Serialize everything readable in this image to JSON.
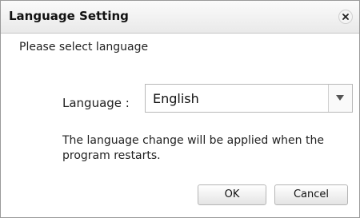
{
  "dialog": {
    "title": "Language Setting",
    "close_icon": "close-icon",
    "prompt": "Please select language",
    "language_label": "Language :",
    "language_select": {
      "selected": "English",
      "arrow_icon": "triangle-down-icon"
    },
    "notice": "The  language change will be applied when the program restarts.",
    "ok_label": "OK",
    "cancel_label": "Cancel"
  }
}
